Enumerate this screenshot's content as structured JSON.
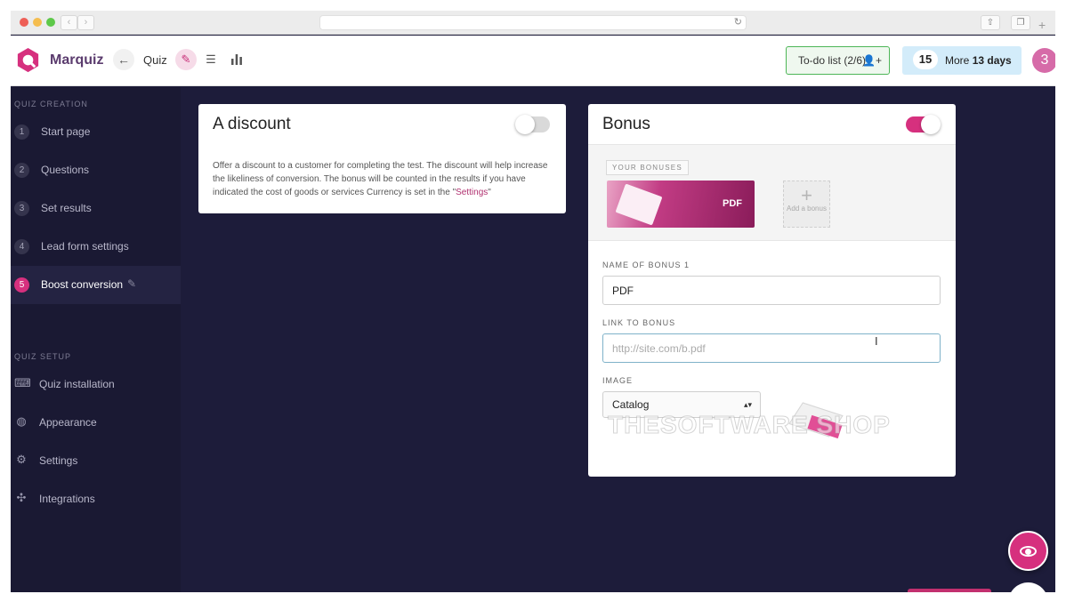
{
  "browser": {
    "url": "",
    "nav_back": "‹",
    "nav_forward": "›",
    "reload": "↻",
    "new_tab": "+"
  },
  "header": {
    "brand": "Marquiz",
    "quiz_label": "Quiz",
    "todo_label": "To-do list (2/6)",
    "days_number": "15",
    "days_prefix": "More",
    "days_value": "13 days",
    "avatar_text": "3",
    "accent_color": "#d6307e"
  },
  "sidebar": {
    "creation_title": "QUIZ CREATION",
    "steps": [
      {
        "num": "1",
        "label": "Start page"
      },
      {
        "num": "2",
        "label": "Questions"
      },
      {
        "num": "3",
        "label": "Set results"
      },
      {
        "num": "4",
        "label": "Lead form settings"
      },
      {
        "num": "5",
        "label": "Boost conversion"
      }
    ],
    "active_step": 5,
    "setup_title": "QUIZ SETUP",
    "setup_items": [
      {
        "label": "Quiz installation",
        "icon": "code-window-icon"
      },
      {
        "label": "Appearance",
        "icon": "palette-icon"
      },
      {
        "label": "Settings",
        "icon": "gear-icon"
      },
      {
        "label": "Integrations",
        "icon": "puzzle-icon"
      }
    ]
  },
  "discount": {
    "title": "A discount",
    "enabled": false,
    "description_before": "Offer a discount to a customer for completing the test. The discount will help increase the likeliness of conversion. The bonus will be counted in the results if you have indicated the cost of goods or services Currency is set in the \"",
    "settings_link": "Settings",
    "description_after": "\""
  },
  "bonus": {
    "title": "Bonus",
    "enabled": true,
    "your_bonuses_label": "YOUR BONUSES",
    "bonus_tile_label": "PDF",
    "add_bonus_label": "Add a bonus",
    "add_plus": "+",
    "name_label": "NAME OF BONUS 1",
    "name_value": "PDF",
    "link_label": "LINK TO BONUS",
    "link_value": "",
    "link_placeholder": "http://site.com/b.pdf",
    "image_label": "IMAGE",
    "image_selected": "Catalog",
    "select_arrow": "▴▾",
    "watermark": "THESOFTWARE SHOP"
  }
}
